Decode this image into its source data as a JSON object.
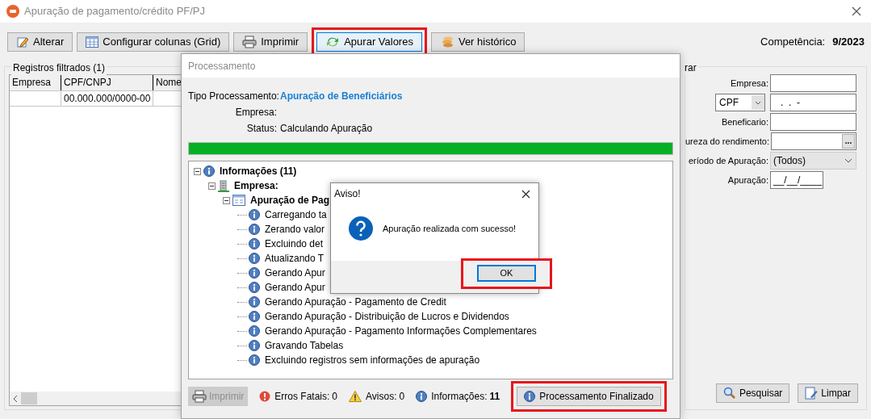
{
  "window": {
    "title": "Apuração de pagamento/crédito PF/PJ"
  },
  "toolbar": [
    {
      "label": "Alterar",
      "highlighted": false
    },
    {
      "label": "Configurar colunas (Grid)",
      "highlighted": false
    },
    {
      "label": "Imprimir",
      "highlighted": false
    },
    {
      "label": "Apurar Valores",
      "highlighted": true
    },
    {
      "label": "Ver histórico",
      "highlighted": false
    }
  ],
  "competencia": {
    "label": "Competência:",
    "value": "9/2023"
  },
  "records_group": {
    "title": "Registros filtrados (1)",
    "columns": [
      "Empresa",
      "CPF/CNPJ",
      "Nome"
    ],
    "rows": [
      {
        "cells": [
          null,
          "00.000.000/0000-00",
          null
        ]
      }
    ]
  },
  "filter_group": {
    "title": "rar",
    "fields": [
      {
        "kind": "text",
        "label": "Empresa:"
      },
      {
        "kind": "select-text",
        "select": "CPF",
        "value": ".  .  -"
      },
      {
        "kind": "text",
        "label": "Beneficario:"
      },
      {
        "kind": "lookup",
        "label": "ureza do rendimento:",
        "button": "..."
      },
      {
        "kind": "dropdown",
        "label": "eríodo de Apuração:",
        "value": "(Todos)"
      },
      {
        "kind": "date",
        "label": "Apuração:",
        "value": "__/__/____"
      }
    ],
    "buttons": [
      {
        "label": "Pesquisar"
      },
      {
        "label": "Limpar"
      }
    ]
  },
  "processing_dialog": {
    "title": "Processamento",
    "fields": [
      {
        "label": "Tipo Processamento:",
        "value": "Apuração de Beneficiários",
        "emphasis": true
      },
      {
        "label": "Empresa:"
      },
      {
        "label": "Status:",
        "value": "Calculando Apuração",
        "emphasis": false
      }
    ],
    "progress": {
      "level": 1.0
    },
    "tree": [
      {
        "label": "Informações (11)",
        "expanded": true,
        "children": [
          {
            "label": "Empresa:",
            "expanded": true,
            "children": [
              {
                "label": "Apuração de Pag",
                "expanded": true,
                "children": [
                  {
                    "label": "Carregando ta"
                  },
                  {
                    "label": "Zerando valor"
                  },
                  {
                    "label": "Excluindo det"
                  },
                  {
                    "label": "Atualizando T"
                  },
                  {
                    "label": "Gerando Apur"
                  },
                  {
                    "label": "Gerando Apur"
                  },
                  {
                    "label": "Gerando Apuração - Pagamento de Credit"
                  },
                  {
                    "label": "Gerando Apuração - Distribuição de Lucros e Dividendos"
                  },
                  {
                    "label": "Gerando Apuração - Pagamento Informações Complementares"
                  },
                  {
                    "label": "Gravando Tabelas"
                  },
                  {
                    "label": "Excluindo registros sem informações de apuração"
                  }
                ]
              }
            ]
          }
        ]
      }
    ],
    "footer": {
      "print_button": {
        "label": "Imprimir",
        "disabled": true
      },
      "counters": [
        {
          "label": "Erros Fatais:",
          "value": "0",
          "bold": false
        },
        {
          "label": "Avisos:",
          "value": "0",
          "bold": false
        },
        {
          "label": "Informações:",
          "value": "11",
          "bold": true
        }
      ],
      "status_button": {
        "label": "Processamento Finalizado",
        "highlighted": true
      }
    }
  },
  "alert": {
    "title": "Aviso!",
    "message": "Apuração realizada com sucesso!",
    "button": {
      "label": "OK",
      "highlighted": true
    }
  }
}
